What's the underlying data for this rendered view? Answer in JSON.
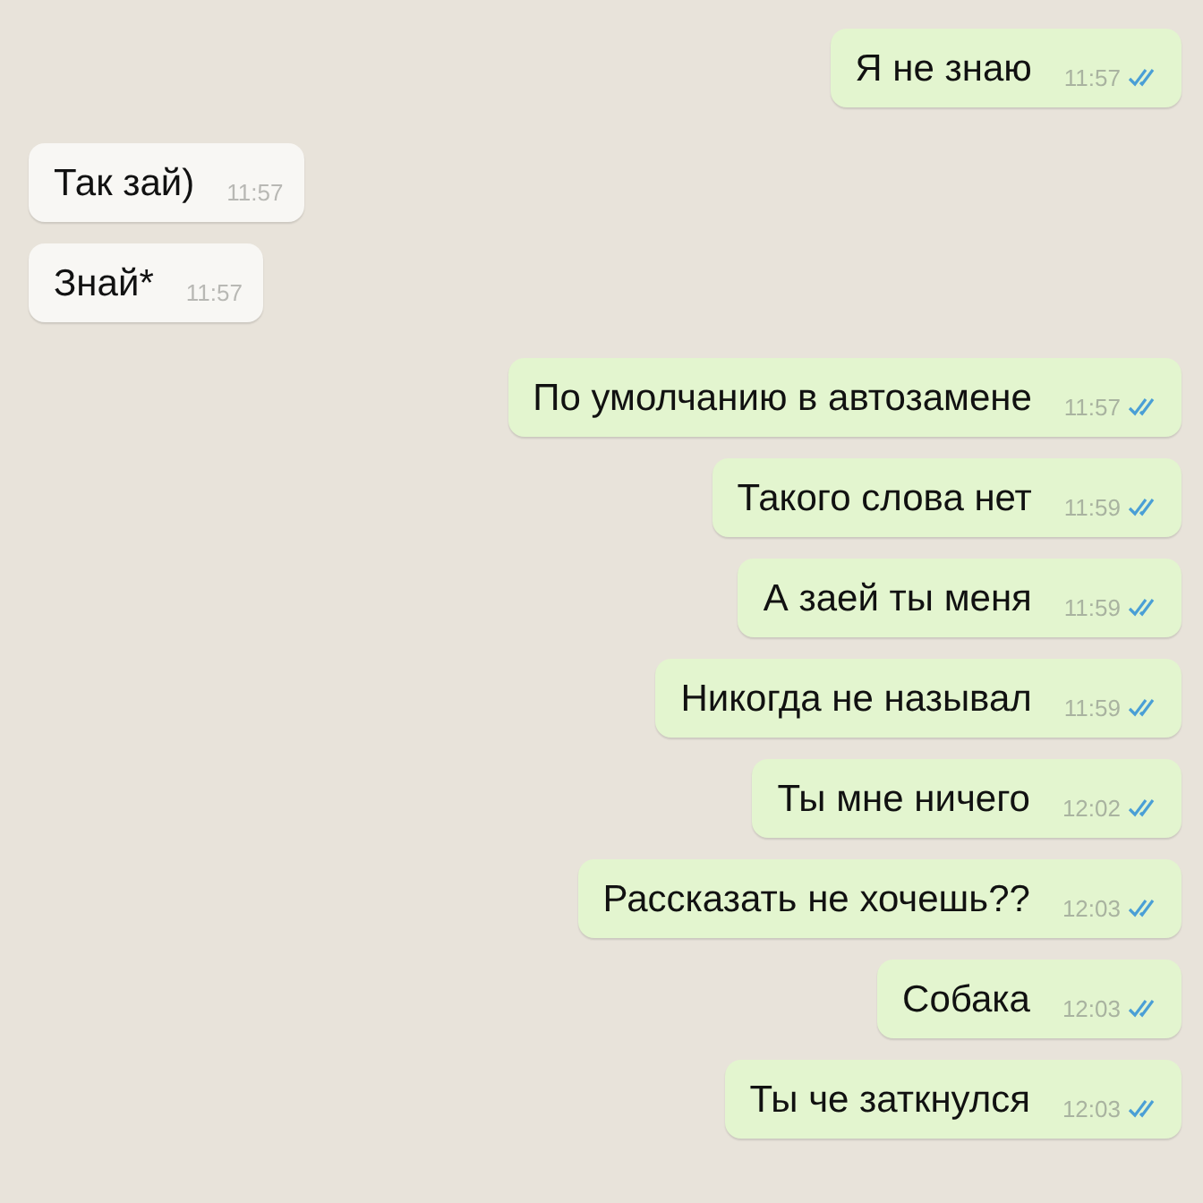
{
  "messages": [
    {
      "kind": "outgoing",
      "text": "Я не знаю",
      "time": "11:57",
      "read": true
    },
    {
      "kind": "incoming",
      "text": "Так зай)",
      "time": "11:57"
    },
    {
      "kind": "incoming",
      "text": "Знай*",
      "time": "11:57"
    },
    {
      "kind": "outgoing",
      "text": "По умолчанию в автозамене",
      "time": "11:57",
      "read": true
    },
    {
      "kind": "outgoing",
      "text": "Такого слова нет",
      "time": "11:59",
      "read": true
    },
    {
      "kind": "outgoing",
      "text": "А заей ты меня",
      "time": "11:59",
      "read": true
    },
    {
      "kind": "outgoing",
      "text": "Никогда не называл",
      "time": "11:59",
      "read": true
    },
    {
      "kind": "outgoing",
      "text": "Ты мне ничего",
      "time": "12:02",
      "read": true
    },
    {
      "kind": "outgoing",
      "text": "Рассказать не хочешь??",
      "time": "12:03",
      "read": true
    },
    {
      "kind": "outgoing",
      "text": "Собака",
      "time": "12:03",
      "read": true
    },
    {
      "kind": "outgoing",
      "text": "Ты че заткнулся",
      "time": "12:03",
      "read": true
    }
  ]
}
